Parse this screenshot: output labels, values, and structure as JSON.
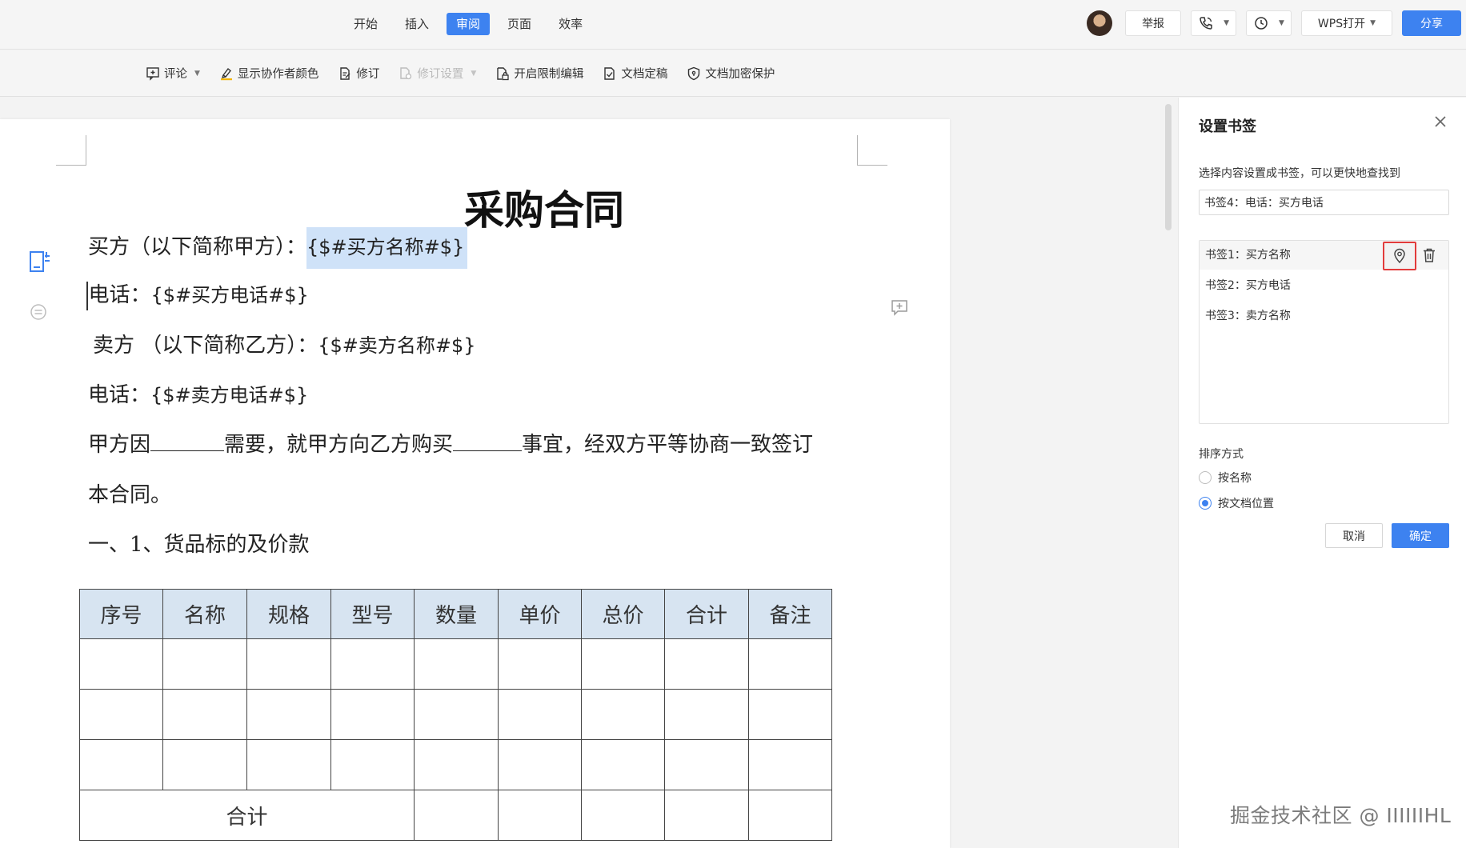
{
  "tabs": [
    {
      "label": "开始",
      "active": false
    },
    {
      "label": "插入",
      "active": false
    },
    {
      "label": "审阅",
      "active": true
    },
    {
      "label": "页面",
      "active": false
    },
    {
      "label": "效率",
      "active": false
    }
  ],
  "topbar": {
    "report_label": "举报",
    "open_wps_label": "WPS打开",
    "share_label": "分享"
  },
  "ribbon": {
    "comment": "评论",
    "collab_color": "显示协作者颜色",
    "revise": "修订",
    "revise_settings": "修订设置",
    "restrict_edit": "开启限制编辑",
    "finalize": "文档定稿",
    "encrypt": "文档加密保护"
  },
  "document": {
    "title": "采购合同",
    "buyer_label": "买方（以下简称甲方）：",
    "buyer_code": "{$#买方名称#$}",
    "buyer_phone_label": "电话：",
    "buyer_phone_code": "{$#买方电话#$}",
    "seller_label": "卖方 （以下简称乙方）：",
    "seller_code": "{$#卖方名称#$}",
    "seller_phone_label": "电话：",
    "seller_phone_code": "{$#卖方电话#$}",
    "para_a": "甲方因",
    "para_b": "需要，就甲方向乙方购买",
    "para_c": "事宜，经双方平等协商一致签订",
    "para_d": "本合同。",
    "section_heading": "一、1、货品标的及价款",
    "table": {
      "headers": [
        "序号",
        "名称",
        "规格",
        "型号",
        "数量",
        "单价",
        "总价",
        "合计",
        "备注"
      ],
      "total_label": "合计"
    }
  },
  "panel": {
    "title": "设置书签",
    "hint": "选择内容设置成书签，可以更快地查找到",
    "input_value": "书签4：电话：买方电话",
    "bookmarks": [
      {
        "label": "书签1：买方名称",
        "selected": true
      },
      {
        "label": "书签2：买方电话",
        "selected": false
      },
      {
        "label": "书签3：卖方名称",
        "selected": false
      }
    ],
    "sort_label": "排序方式",
    "sort_options": [
      {
        "label": "按名称",
        "checked": false
      },
      {
        "label": "按文档位置",
        "checked": true
      }
    ],
    "cancel_label": "取消",
    "ok_label": "确定"
  },
  "watermark": "掘金技术社区 @ IIIIIIHL",
  "colors": {
    "accent": "#3d82f0",
    "highlight": "#cfe2f8",
    "table_header": "#d7e4f1",
    "focus_border": "#e23b3b"
  }
}
